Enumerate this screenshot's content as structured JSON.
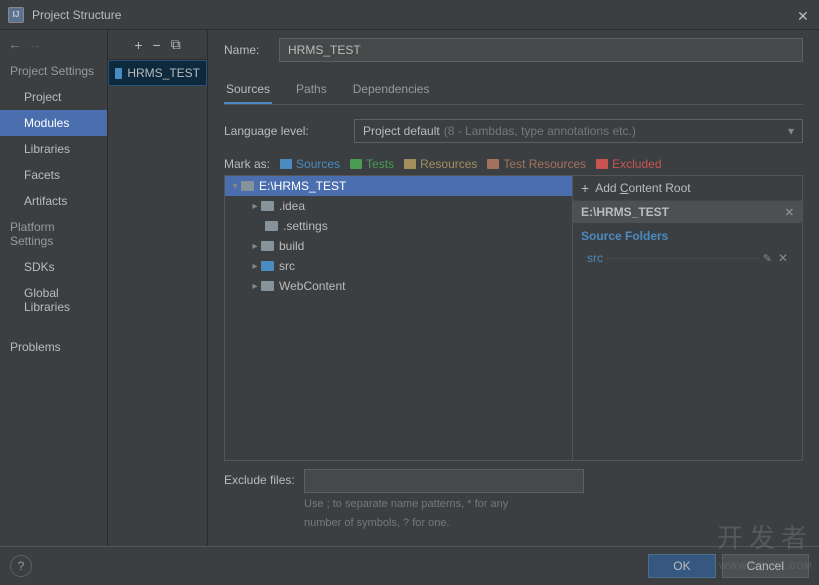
{
  "window": {
    "title": "Project Structure"
  },
  "nav": {
    "section1": "Project Settings",
    "items1": [
      "Project",
      "Modules",
      "Libraries",
      "Facets",
      "Artifacts"
    ],
    "section2": "Platform Settings",
    "items2": [
      "SDKs",
      "Global Libraries"
    ],
    "problems": "Problems"
  },
  "modules": {
    "selected": "HRMS_TEST"
  },
  "name": {
    "label": "Name:",
    "value": "HRMS_TEST"
  },
  "tabs": {
    "sources": "Sources",
    "paths": "Paths",
    "deps": "Dependencies"
  },
  "language": {
    "label": "Language level:",
    "value": "Project default",
    "hint": "(8 - Lambdas, type annotations etc.)"
  },
  "mark": {
    "label": "Mark as:",
    "sources": "Sources",
    "tests": "Tests",
    "resources": "Resources",
    "testres": "Test Resources",
    "excluded": "Excluded"
  },
  "tree": {
    "root": "E:\\HRMS_TEST",
    "items": [
      {
        "name": ".idea",
        "expandable": true,
        "type": "folder"
      },
      {
        "name": ".settings",
        "expandable": false,
        "type": "folder"
      },
      {
        "name": "build",
        "expandable": true,
        "type": "folder"
      },
      {
        "name": "src",
        "expandable": true,
        "type": "src"
      },
      {
        "name": "WebContent",
        "expandable": true,
        "type": "folder"
      }
    ]
  },
  "rightPane": {
    "addRoot": "Add Content Root",
    "root": "E:\\HRMS_TEST",
    "sourceFolders": "Source Folders",
    "items": [
      "src"
    ]
  },
  "exclude": {
    "label": "Exclude files:",
    "hint1": "Use ; to separate name patterns, * for any",
    "hint2": "number of symbols, ? for one."
  },
  "footer": {
    "ok": "OK",
    "cancel": "Cancel"
  },
  "watermark": {
    "line1": "开发者",
    "line2": "WWW.DEVZE.COM"
  }
}
